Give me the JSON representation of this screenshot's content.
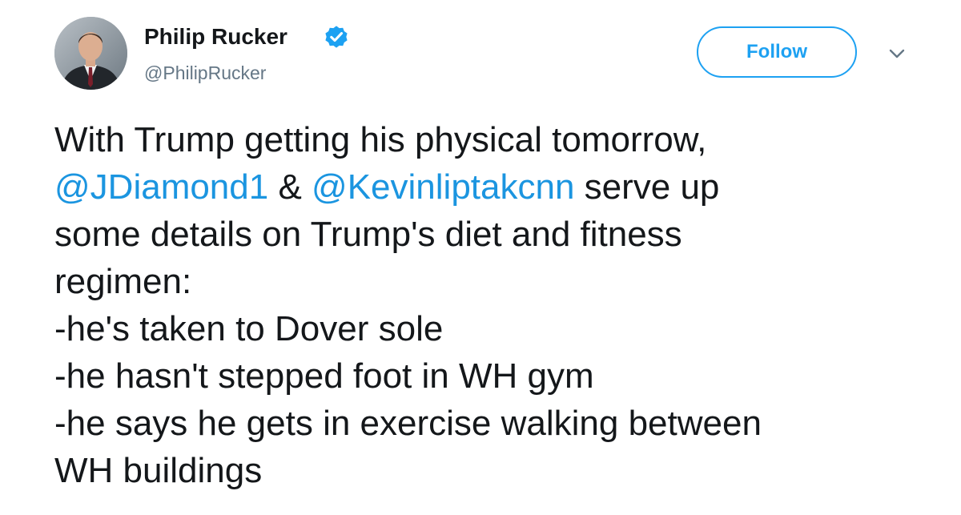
{
  "author": {
    "name": "Philip Rucker",
    "handle": "@PhilipRucker",
    "verified": true
  },
  "actions": {
    "follow_label": "Follow",
    "more_icon": "chevron-down-icon"
  },
  "tweet": {
    "line1": "With Trump getting his physical tomorrow,",
    "mention1": "@JDiamond1",
    "connector": " & ",
    "mention2": "@Kevinliptakcnn",
    "line2_rest": " serve up",
    "line3": "some details on Trump's diet and fitness",
    "line4": "regimen:",
    "line5": "-he's taken to Dover sole",
    "line6": "-he hasn't stepped foot in WH gym",
    "line7": "-he says he gets in exercise walking between",
    "line8": "WH buildings"
  },
  "colors": {
    "accent": "#1da1f2",
    "mention": "#1b95e0",
    "text": "#14171a",
    "secondary": "#657786"
  }
}
